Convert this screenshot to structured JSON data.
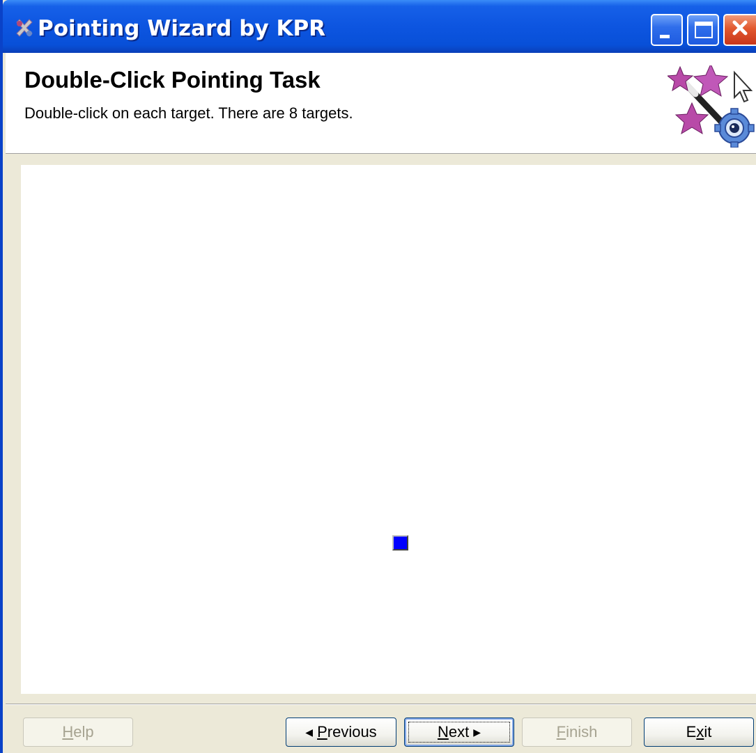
{
  "window": {
    "title": "Pointing Wizard by KPR",
    "app_icon": "kpr-wizard-icon",
    "controls": [
      "minimize-icon",
      "maximize-icon",
      "close-icon"
    ]
  },
  "header": {
    "title": "Double-Click Pointing Task",
    "subtitle": "Double-click on each target. There are 8 targets.",
    "logo_icon": "wizard-stars-cursor-gear-icon"
  },
  "task": {
    "target_color": "#0000FF"
  },
  "buttons": {
    "help": {
      "mnemonic": "H",
      "rest": "elp",
      "enabled": false
    },
    "previous": {
      "mnemonic": "P",
      "rest": "revious",
      "enabled": true
    },
    "next": {
      "mnemonic": "N",
      "rest": "ext",
      "enabled": true,
      "focused": true
    },
    "finish": {
      "mnemonic": "F",
      "rest": "inish",
      "enabled": false
    },
    "exit": {
      "pre": "E",
      "mnemonic": "x",
      "rest": "it",
      "enabled": true
    }
  },
  "colors": {
    "titlebar_blue": "#0D55E0",
    "close_red": "#E2582E",
    "dialog_bg": "#ECE9D8"
  }
}
